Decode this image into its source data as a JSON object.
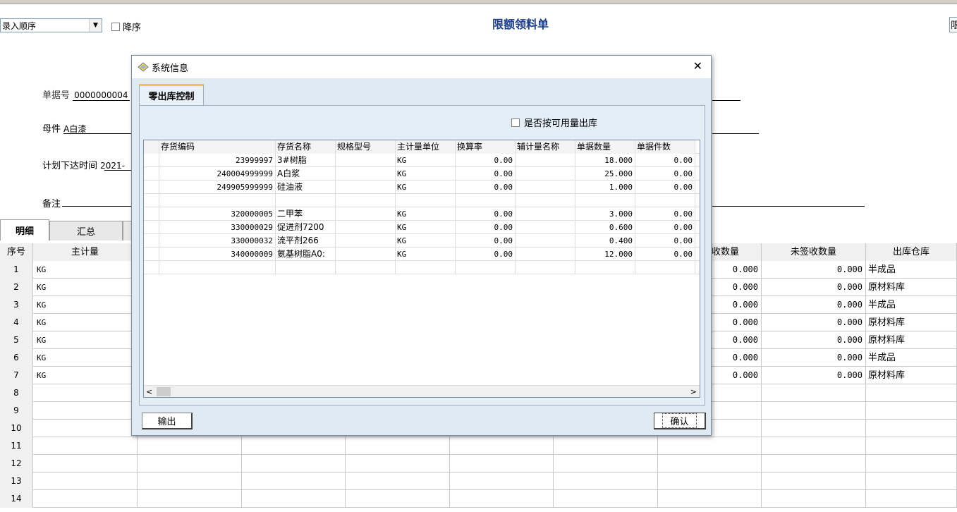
{
  "toolbar": {},
  "sort": {
    "value": "录入顺序",
    "desc_label": "降序"
  },
  "page_title": "限额领料单",
  "right_edge": "限",
  "header_fields": {
    "doc_no_label": "单据号",
    "doc_no_value": "0000000004",
    "parent_label": "母件",
    "parent_value": "A白漆",
    "plan_time_label": "计划下达时间",
    "plan_time_value": "2021-",
    "remark_label": "备注"
  },
  "detail_tabs": [
    "明细",
    "汇总",
    ""
  ],
  "main_grid": {
    "headers": [
      "序号",
      "主计量",
      "",
      "",
      "",
      "",
      "",
      "收数量",
      "未签收数量",
      "出库仓库"
    ],
    "rows": [
      {
        "seq": "1",
        "unit": "KG",
        "recv": "0.000",
        "unsigned": "0.000",
        "wh": "半成品"
      },
      {
        "seq": "2",
        "unit": "KG",
        "recv": "0.000",
        "unsigned": "0.000",
        "wh": "原材料库"
      },
      {
        "seq": "3",
        "unit": "KG",
        "recv": "0.000",
        "unsigned": "0.000",
        "wh": "半成品"
      },
      {
        "seq": "4",
        "unit": "KG",
        "recv": "0.000",
        "unsigned": "0.000",
        "wh": "原材料库"
      },
      {
        "seq": "5",
        "unit": "KG",
        "recv": "0.000",
        "unsigned": "0.000",
        "wh": "原材料库"
      },
      {
        "seq": "6",
        "unit": "KG",
        "recv": "0.000",
        "unsigned": "0.000",
        "wh": "半成品"
      },
      {
        "seq": "7",
        "unit": "KG",
        "recv": "0.000",
        "unsigned": "0.000",
        "wh": "原材料库"
      },
      {
        "seq": "8",
        "unit": "",
        "recv": "",
        "unsigned": "",
        "wh": ""
      },
      {
        "seq": "9",
        "unit": "",
        "recv": "",
        "unsigned": "",
        "wh": ""
      },
      {
        "seq": "10",
        "unit": "",
        "recv": "",
        "unsigned": "",
        "wh": ""
      },
      {
        "seq": "11",
        "unit": "",
        "recv": "",
        "unsigned": "",
        "wh": ""
      },
      {
        "seq": "12",
        "unit": "",
        "recv": "",
        "unsigned": "",
        "wh": ""
      },
      {
        "seq": "13",
        "unit": "",
        "recv": "",
        "unsigned": "",
        "wh": ""
      },
      {
        "seq": "14",
        "unit": "",
        "recv": "",
        "unsigned": "",
        "wh": ""
      }
    ]
  },
  "dialog": {
    "title": "系统信息",
    "close_glyph": "✕",
    "tab_label": "零出库控制",
    "avail_label": "是否按可用量出库",
    "columns": [
      "存货编码",
      "存货名称",
      "规格型号",
      "主计量单位",
      "换算率",
      "辅计量名称",
      "单据数量",
      "单据件数"
    ],
    "rows": [
      [
        "23999997",
        "3#树脂",
        "",
        "KG",
        "0.00",
        "",
        "18.000",
        "0.00"
      ],
      [
        "240004999999",
        "A白浆",
        "",
        "KG",
        "0.00",
        "",
        "25.000",
        "0.00"
      ],
      [
        "249905999999",
        "硅油液",
        "",
        "KG",
        "0.00",
        "",
        "1.000",
        "0.00"
      ],
      [
        "",
        "",
        "",
        "",
        "",
        "",
        "",
        ""
      ],
      [
        "320000005",
        "二甲苯",
        "",
        "KG",
        "0.00",
        "",
        "3.000",
        "0.00"
      ],
      [
        "330000029",
        "促进剂7200",
        "",
        "KG",
        "0.00",
        "",
        "0.600",
        "0.00"
      ],
      [
        "330000032",
        "流平剂266",
        "",
        "KG",
        "0.00",
        "",
        "0.400",
        "0.00"
      ],
      [
        "340000009",
        "氨基树脂A0:",
        "",
        "KG",
        "0.00",
        "",
        "12.000",
        "0.00"
      ],
      [
        "",
        "",
        "",
        "",
        "",
        "",
        "",
        ""
      ]
    ],
    "scroll_left": "<",
    "scroll_right": ">",
    "export_label": "输出",
    "ok_label": "确认"
  }
}
